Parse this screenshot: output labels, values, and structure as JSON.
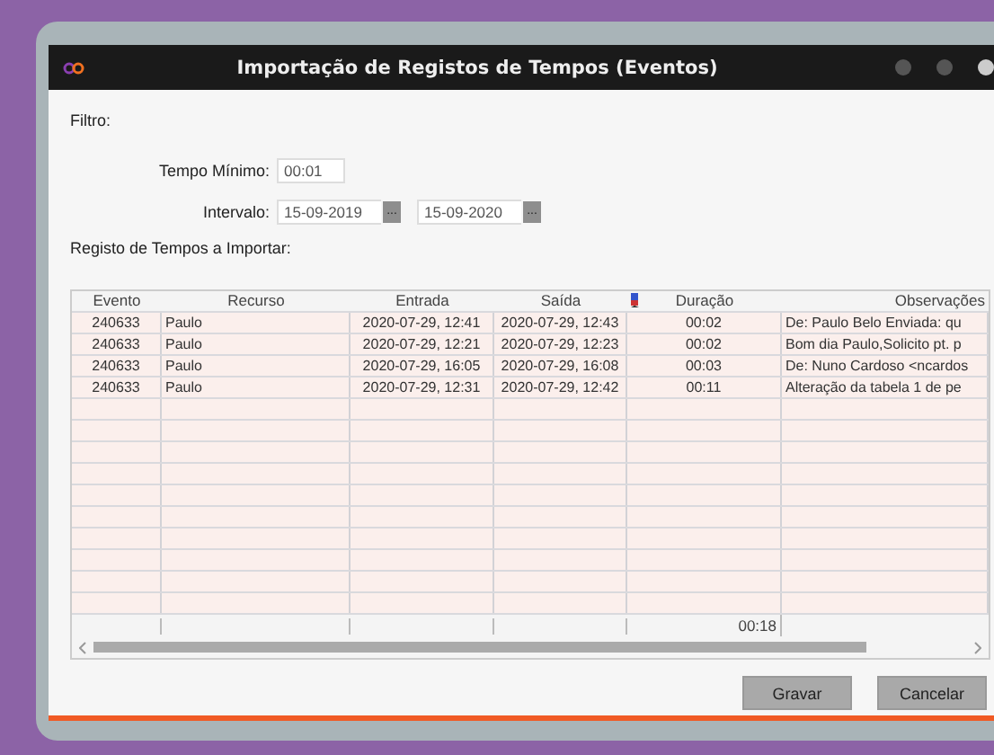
{
  "window": {
    "title": "Importação de Registos de Tempos (Eventos)"
  },
  "filter": {
    "label": "Filtro:",
    "min_time": {
      "label": "Tempo Mínimo:",
      "value": "00:01"
    },
    "interval": {
      "label": "Intervalo:",
      "from": "15-09-2019",
      "to": "15-09-2020",
      "picker_label": "..."
    }
  },
  "table": {
    "title": "Registo de Tempos a Importar:",
    "columns": [
      "Evento",
      "Recurso",
      "Entrada",
      "Saída",
      "Duração",
      "Observações"
    ],
    "rows": [
      [
        "240633",
        "Paulo",
        "2020-07-29, 12:41",
        "2020-07-29, 12:43",
        "00:02",
        "De: Paulo Belo Enviada: qu"
      ],
      [
        "240633",
        "Paulo",
        "2020-07-29, 12:21",
        "2020-07-29, 12:23",
        "00:02",
        "Bom dia Paulo,Solicito pt. p"
      ],
      [
        "240633",
        "Paulo",
        "2020-07-29, 16:05",
        "2020-07-29, 16:08",
        "00:03",
        "De: Nuno Cardoso <ncardos"
      ],
      [
        "240633",
        "Paulo",
        "2020-07-29, 12:31",
        "2020-07-29, 12:42",
        "00:11",
        "Alteração da tabela 1 de pe"
      ]
    ],
    "total": "00:18"
  },
  "buttons": [
    "Gravar",
    "Cancelar"
  ]
}
